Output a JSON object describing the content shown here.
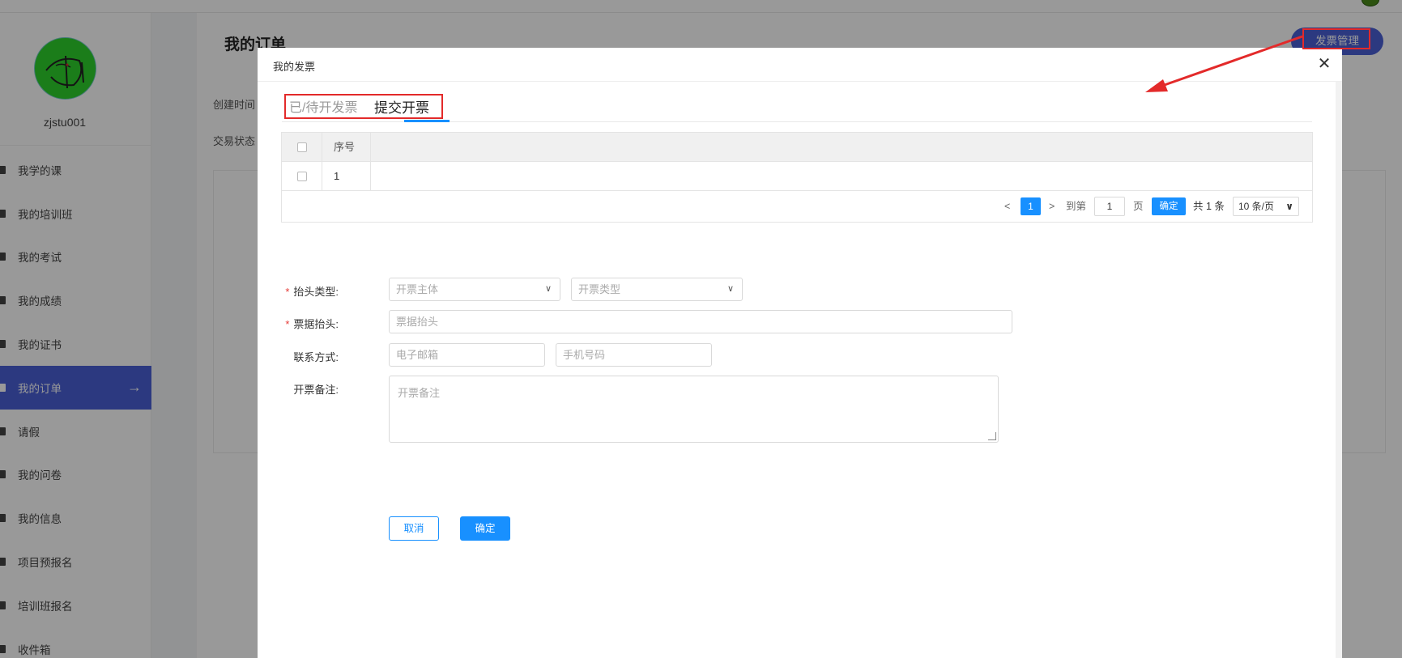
{
  "sidebar": {
    "username": "zjstu001",
    "items": [
      {
        "label": "我学的课",
        "icon": "briefcase-icon"
      },
      {
        "label": "我的培训班",
        "icon": "list-icon"
      },
      {
        "label": "我的考试",
        "icon": "briefcase-icon"
      },
      {
        "label": "我的成绩",
        "icon": "briefcase-icon"
      },
      {
        "label": "我的证书",
        "icon": "briefcase-icon"
      },
      {
        "label": "我的订单",
        "icon": "list-icon",
        "active": true
      },
      {
        "label": "请假",
        "icon": "list-icon"
      },
      {
        "label": "我的问卷",
        "icon": "list-icon"
      },
      {
        "label": "我的信息",
        "icon": "list-icon"
      },
      {
        "label": "项目预报名",
        "icon": "briefcase-icon"
      },
      {
        "label": "培训班报名",
        "icon": "list-icon"
      },
      {
        "label": "收件箱",
        "icon": "inbox-icon"
      }
    ]
  },
  "page": {
    "title": "我的订单",
    "label_created": "创建时间",
    "label_status": "交易状态",
    "invoice_button": "发票管理"
  },
  "modal": {
    "title": "我的发票",
    "close": "✕",
    "tabs": [
      "已/待开发票",
      "提交开票"
    ],
    "active_tab": 1,
    "table": {
      "headers": [
        "序号"
      ],
      "rows": [
        [
          "1"
        ]
      ]
    },
    "pager": {
      "prev": "<",
      "current": "1",
      "next": ">",
      "goto": "到第",
      "goto_value": "1",
      "page_unit": "页",
      "ok": "确定",
      "total": "共 1 条",
      "page_size": "10 条/页"
    },
    "form": {
      "header_type_label": "抬头类型:",
      "subject_placeholder": "开票主体",
      "invoice_type_placeholder": "开票类型",
      "title_label": "票据抬头:",
      "title_placeholder": "票据抬头",
      "contact_label": "联系方式:",
      "email_placeholder": "电子邮箱",
      "phone_placeholder": "手机号码",
      "remark_label": "开票备注:",
      "remark_placeholder": "开票备注",
      "required_mark": "*",
      "cancel": "取消",
      "submit": "确定"
    }
  },
  "colors": {
    "primary": "#1890ff",
    "sidebar_active": "#4a5fd6",
    "annotation": "#e32a2a"
  }
}
